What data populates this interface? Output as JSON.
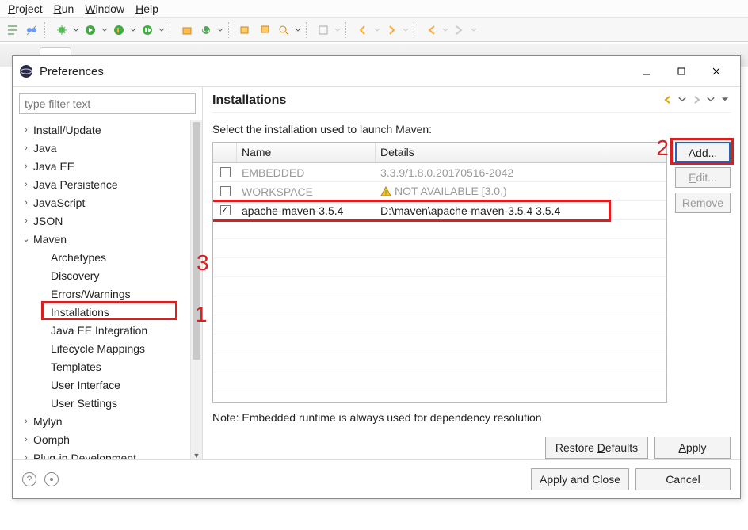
{
  "menubar": {
    "project_html": "<u>P</u>roject",
    "run_html": "<u>R</u>un",
    "window_html": "<u>W</u>indow",
    "help_html": "<u>H</u>elp"
  },
  "dialog": {
    "title": "Preferences",
    "filter_placeholder": "type filter text"
  },
  "tree": [
    {
      "label": "Install/Update",
      "expander": "›",
      "depth": 0
    },
    {
      "label": "Java",
      "expander": "›",
      "depth": 0
    },
    {
      "label": "Java EE",
      "expander": "›",
      "depth": 0
    },
    {
      "label": "Java Persistence",
      "expander": "›",
      "depth": 0
    },
    {
      "label": "JavaScript",
      "expander": "›",
      "depth": 0
    },
    {
      "label": "JSON",
      "expander": "›",
      "depth": 0
    },
    {
      "label": "Maven",
      "expander": "⌄",
      "depth": 0
    },
    {
      "label": "Archetypes",
      "expander": "",
      "depth": 1
    },
    {
      "label": "Discovery",
      "expander": "",
      "depth": 1
    },
    {
      "label": "Errors/Warnings",
      "expander": "",
      "depth": 1
    },
    {
      "label": "Installations",
      "expander": "",
      "depth": 1,
      "selected": true
    },
    {
      "label": "Java EE Integration",
      "expander": "",
      "depth": 1
    },
    {
      "label": "Lifecycle Mappings",
      "expander": "",
      "depth": 1
    },
    {
      "label": "Templates",
      "expander": "",
      "depth": 1
    },
    {
      "label": "User Interface",
      "expander": "",
      "depth": 1
    },
    {
      "label": "User Settings",
      "expander": "",
      "depth": 1
    },
    {
      "label": "Mylyn",
      "expander": "›",
      "depth": 0
    },
    {
      "label": "Oomph",
      "expander": "›",
      "depth": 0
    },
    {
      "label": "Plug-in Development",
      "expander": "›",
      "depth": 0
    }
  ],
  "right": {
    "heading": "Installations",
    "subtitle": "Select the installation used to launch Maven:",
    "columns": {
      "name": "Name",
      "details": "Details"
    },
    "rows": [
      {
        "checked": false,
        "name": "EMBEDDED",
        "details": "3.3.9/1.8.0.20170516-2042",
        "disabled": true
      },
      {
        "checked": false,
        "name": "WORKSPACE",
        "details": "NOT AVAILABLE [3.0,)",
        "disabled": true,
        "warn": true
      },
      {
        "checked": true,
        "name": "apache-maven-3.5.4",
        "details": "D:\\maven\\apache-maven-3.5.4 3.5.4",
        "disabled": false
      }
    ],
    "btn_add_html": "<u>A</u>dd...",
    "btn_edit_html": "<u>E</u>dit...",
    "btn_remove": "Remove",
    "note": "Note: Embedded runtime is always used for dependency resolution",
    "restore_html": "Restore <u>D</u>efaults",
    "apply_html": "<u>A</u>pply"
  },
  "dlg_bottom": {
    "apply_close": "Apply and Close",
    "cancel": "Cancel"
  },
  "annotations": {
    "one": "1",
    "two": "2",
    "three": "3"
  }
}
